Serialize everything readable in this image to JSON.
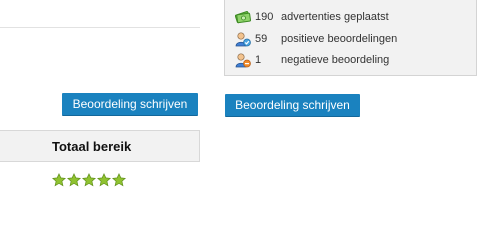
{
  "stats": {
    "items": [
      {
        "icon": "money-icon",
        "count": "190",
        "label": "advertenties geplaatst"
      },
      {
        "icon": "user-positive-icon",
        "count": "59",
        "label": "positieve beoordelingen"
      },
      {
        "icon": "user-negative-icon",
        "count": "1",
        "label": "negatieve beoordeling"
      }
    ]
  },
  "buttons": {
    "write_review_left": "Beoordeling schrijven",
    "write_review_right": "Beoordeling schrijven"
  },
  "total": {
    "title": "Totaal bereik",
    "rating": 5,
    "rating_max": 5,
    "star_color": "#8fc230"
  },
  "colors": {
    "button_bg": "#1a82bf",
    "panel_bg": "#f2f2f2"
  }
}
